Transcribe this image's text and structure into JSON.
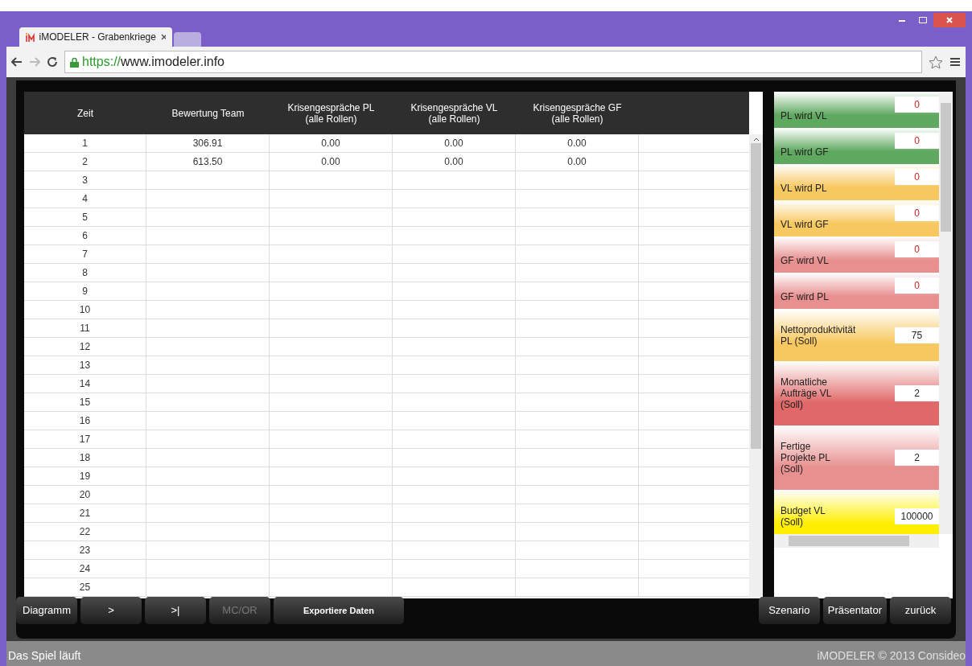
{
  "browser": {
    "tabs": [
      {
        "title": "iMODELER - Grabenkriege",
        "selected": true
      },
      {
        "selected": false
      }
    ],
    "url_scheme": "https://",
    "url_host": "www.imodeler.info"
  },
  "table": {
    "columns": [
      "Zeit",
      "Bewertung Team",
      "Krisengespräche PL\n(alle Rollen)",
      "Krisengespräche VL\n(alle Rollen)",
      "Krisengespräche GF\n(alle Rollen)"
    ],
    "rows": [
      {
        "zeit": "1",
        "values": [
          "306.91",
          "0.00",
          "0.00",
          "0.00"
        ]
      },
      {
        "zeit": "2",
        "values": [
          "613.50",
          "0.00",
          "0.00",
          "0.00"
        ]
      },
      {
        "zeit": "3"
      },
      {
        "zeit": "4"
      },
      {
        "zeit": "5"
      },
      {
        "zeit": "6"
      },
      {
        "zeit": "7"
      },
      {
        "zeit": "8"
      },
      {
        "zeit": "9"
      },
      {
        "zeit": "10"
      },
      {
        "zeit": "11"
      },
      {
        "zeit": "12"
      },
      {
        "zeit": "13"
      },
      {
        "zeit": "14"
      },
      {
        "zeit": "15"
      },
      {
        "zeit": "16"
      },
      {
        "zeit": "17"
      },
      {
        "zeit": "18"
      },
      {
        "zeit": "19"
      },
      {
        "zeit": "20"
      },
      {
        "zeit": "21"
      },
      {
        "zeit": "22"
      },
      {
        "zeit": "23"
      },
      {
        "zeit": "24"
      },
      {
        "zeit": "25"
      }
    ]
  },
  "parameters": [
    {
      "label": "PL wird VL",
      "value": "0",
      "color": "#5fa85f",
      "highlighted": true
    },
    {
      "label": "PL wird GF",
      "value": "0",
      "color": "#5fa85f",
      "highlighted": true
    },
    {
      "label": "VL wird PL",
      "value": "0",
      "color": "#f8c860",
      "highlighted": true
    },
    {
      "label": "VL wird GF",
      "value": "0",
      "color": "#f8c860",
      "highlighted": true
    },
    {
      "label": "GF wird VL",
      "value": "0",
      "color": "#e89090",
      "highlighted": true
    },
    {
      "label": "GF wird PL",
      "value": "0",
      "color": "#e89090",
      "highlighted": true
    },
    {
      "label": "Nettoproduktivität\nPL (Soll)",
      "value": "75",
      "color": "#f8c860",
      "highlighted": false
    },
    {
      "label": "Monatliche\nAufträge VL\n(Soll)",
      "value": "2",
      "color": "#e06868",
      "highlighted": false
    },
    {
      "label": "Fertige\nProjekte PL\n(Soll)",
      "value": "2",
      "color": "#e89090",
      "highlighted": false
    },
    {
      "label": "Budget VL\n(Soll)",
      "value": "100000",
      "color": "#ffee00",
      "highlighted": false
    }
  ],
  "left_buttons": [
    {
      "label": "Diagramm",
      "disabled": false
    },
    {
      "label": ">",
      "disabled": false
    },
    {
      "label": ">|",
      "disabled": false
    },
    {
      "label": "MC/OR",
      "disabled": true
    },
    {
      "label": "Exportiere Daten",
      "disabled": false
    }
  ],
  "right_buttons": [
    {
      "label": "Szenario",
      "disabled": false
    },
    {
      "label": "Präsentator",
      "disabled": false
    },
    {
      "label": "zurück",
      "disabled": false
    }
  ],
  "status_bar": {
    "message": "Das Spiel läuft",
    "copyright": "iMODELER © 2013 Consideo"
  }
}
